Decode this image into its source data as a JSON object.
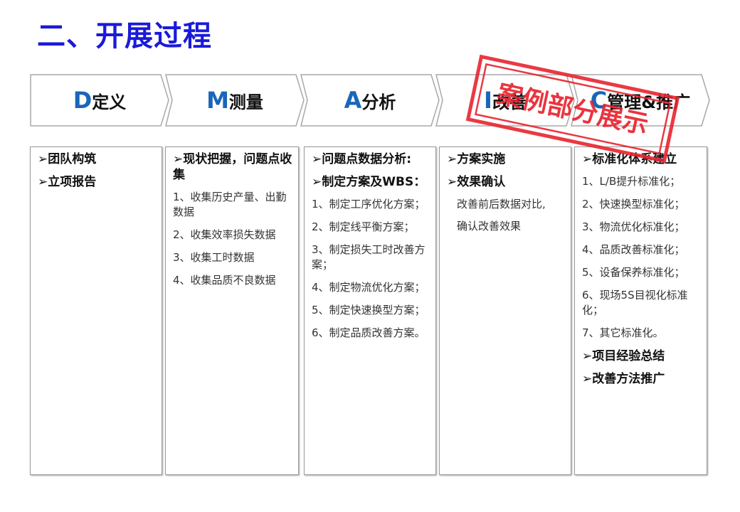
{
  "title": "二、开展过程",
  "phases": [
    {
      "letter": "D",
      "rest": "定义"
    },
    {
      "letter": "M",
      "rest": "测量"
    },
    {
      "letter": "A",
      "rest": "分析"
    },
    {
      "letter": "I",
      "rest": "改善"
    },
    {
      "letter": "C",
      "rest": "管理&推广"
    }
  ],
  "columns": {
    "define": {
      "h1": "➢团队构筑",
      "h2": "➢立项报告"
    },
    "measure": {
      "h1": "➢现状把握，问题点收集",
      "items": [
        "1、收集历史产量、出勤数据",
        "2、收集效率损失数据",
        "3、收集工时数据",
        "4、收集品质不良数据"
      ]
    },
    "analyze": {
      "h1": "➢问题点数据分析:",
      "h2": "➢制定方案及WBS：",
      "items": [
        "1、制定工序优化方案；",
        "2、制定线平衡方案；",
        "3、制定损失工时改善方案；",
        "4、制定物流优化方案；",
        "5、制定快速换型方案；",
        "6、制定品质改善方案。"
      ]
    },
    "improve": {
      "h1": "➢方案实施",
      "h2": "➢效果确认",
      "sub1": "改善前后数据对比,",
      "sub2": "确认改善效果"
    },
    "control": {
      "h1": "➢标准化体系建立",
      "items": [
        "1、L/B提升标准化；",
        "2、快速换型标准化；",
        "3、物流优化标准化；",
        "4、品质改善标准化；",
        "5、设备保养标准化；",
        "6、现场5S目视化标准化；",
        "7、其它标准化。"
      ],
      "h2": "➢项目经验总结",
      "h3": "➢改善方法推广"
    }
  },
  "stamp": {
    "text": "案例部分展示",
    "color": "#e8242f"
  },
  "colors": {
    "title": "#1a1adb",
    "letter": "#1a66b8"
  }
}
